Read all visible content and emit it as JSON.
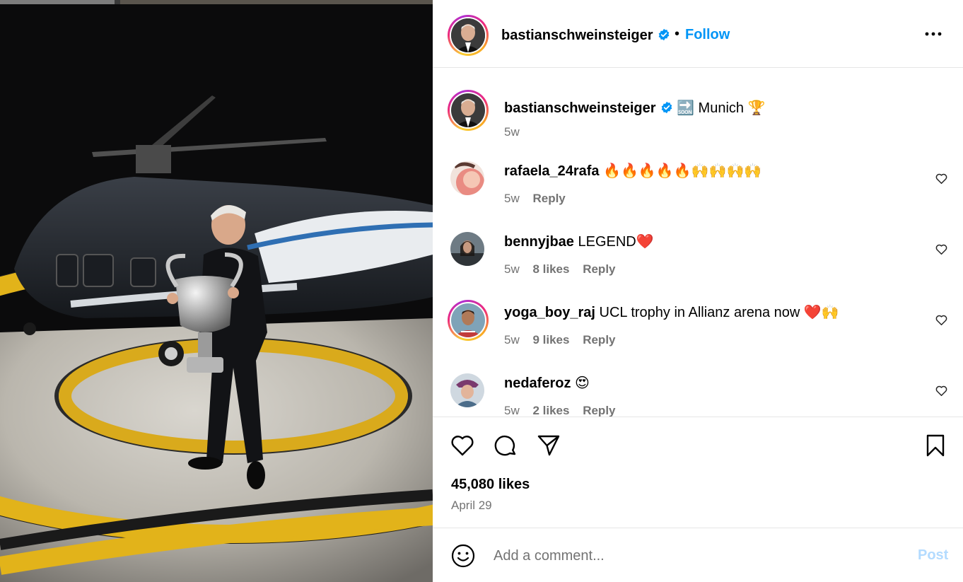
{
  "post": {
    "author": "bastianschweinsteiger",
    "follow_label": "Follow",
    "separator": "•",
    "more_icon": "more-options-icon",
    "caption": {
      "text": "🔜 Munich 🏆",
      "time": "5w"
    }
  },
  "comments": [
    {
      "user": "rafaela_24rafa",
      "text": "🔥🔥🔥🔥🔥🙌🙌🙌🙌",
      "time": "5w",
      "likes": "",
      "reply": "Reply"
    },
    {
      "user": "bennyjbae",
      "text": "LEGEND❤️",
      "time": "5w",
      "likes": "8 likes",
      "reply": "Reply"
    },
    {
      "user": "yoga_boy_raj",
      "text": "UCL trophy in Allianz arena now ❤️🙌",
      "time": "5w",
      "likes": "9 likes",
      "reply": "Reply"
    },
    {
      "user": "nedaferoz",
      "text": "😍",
      "time": "5w",
      "likes": "2 likes",
      "reply": "Reply"
    }
  ],
  "actions": {
    "likes": "45,080 likes",
    "date": "April 29"
  },
  "comment_box": {
    "placeholder": "Add a comment...",
    "post_label": "Post"
  },
  "colors": {
    "accent": "#0095f6",
    "post_disabled": "#b3dbff",
    "muted": "#737373"
  }
}
